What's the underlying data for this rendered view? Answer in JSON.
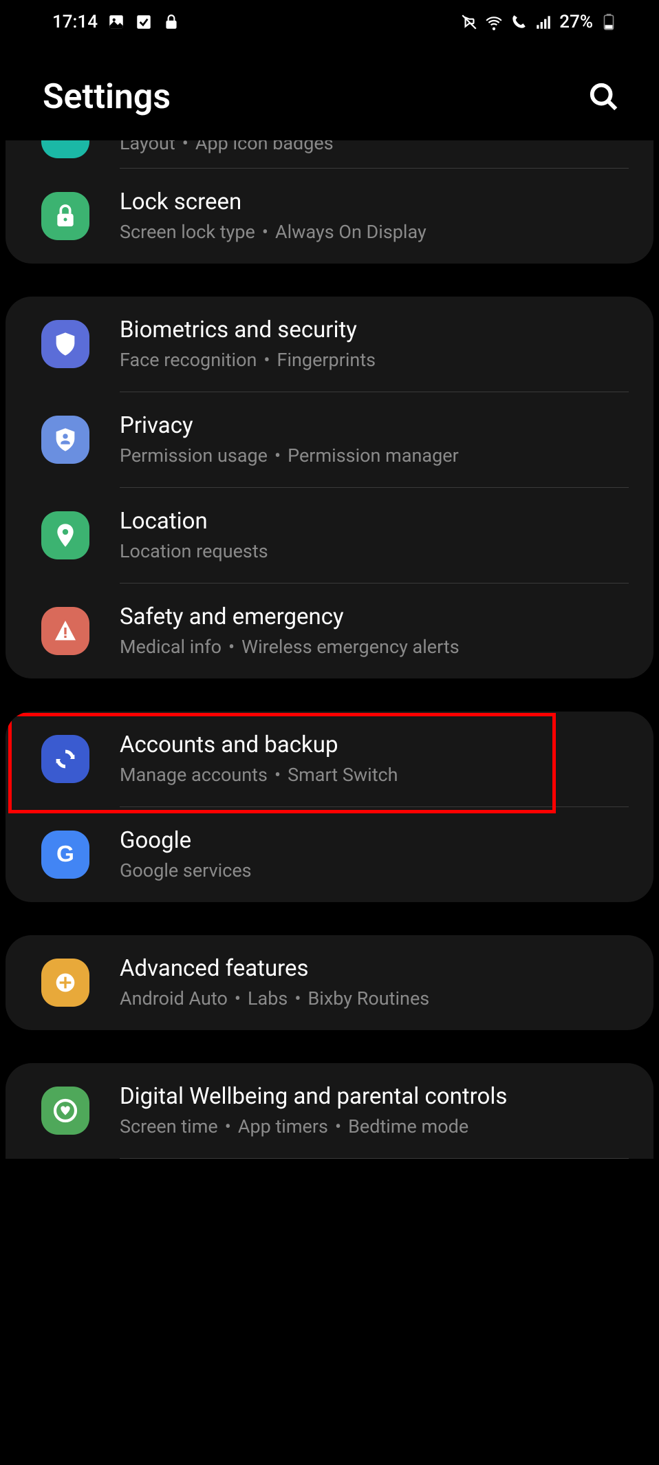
{
  "status": {
    "time": "17:14",
    "battery_pct": "27%"
  },
  "header": {
    "title": "Settings"
  },
  "partial_top": {
    "sub1": "Layout",
    "sub2": "App icon badges"
  },
  "groups": [
    {
      "items": [
        {
          "title": "Lock screen",
          "sub1": "Screen lock type",
          "sub2": "Always On Display",
          "icon": "lock",
          "color": "ic-green"
        }
      ]
    },
    {
      "items": [
        {
          "title": "Biometrics and security",
          "sub1": "Face recognition",
          "sub2": "Fingerprints",
          "icon": "shield",
          "color": "ic-blue"
        },
        {
          "title": "Privacy",
          "sub1": "Permission usage",
          "sub2": "Permission manager",
          "icon": "shield-person",
          "color": "ic-lightblue"
        },
        {
          "title": "Location",
          "sub1": "Location requests",
          "sub2": "",
          "icon": "pin",
          "color": "ic-green"
        },
        {
          "title": "Safety and emergency",
          "sub1": "Medical info",
          "sub2": "Wireless emergency alerts",
          "icon": "alert",
          "color": "ic-red"
        }
      ]
    },
    {
      "items": [
        {
          "title": "Accounts and backup",
          "sub1": "Manage accounts",
          "sub2": "Smart Switch",
          "icon": "sync",
          "color": "ic-dblue",
          "highlighted": true
        },
        {
          "title": "Google",
          "sub1": "Google services",
          "sub2": "",
          "icon": "google",
          "color": "ic-gblue"
        }
      ]
    },
    {
      "items": [
        {
          "title": "Advanced features",
          "sub1": "Android Auto",
          "sub2": "Labs",
          "sub3": "Bixby Routines",
          "icon": "plus-gear",
          "color": "ic-yellow"
        }
      ]
    },
    {
      "items": [
        {
          "title": "Digital Wellbeing and parental controls",
          "sub1": "Screen time",
          "sub2": "App timers",
          "sub3": "Bedtime mode",
          "icon": "wellbeing",
          "color": "ic-dgreen"
        }
      ]
    }
  ]
}
